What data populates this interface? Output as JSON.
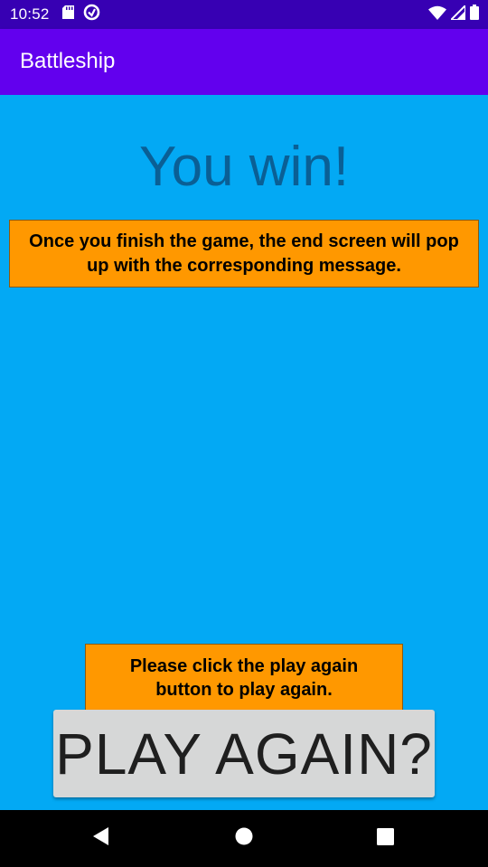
{
  "status_bar": {
    "time": "10:52",
    "icons": [
      "sd-card-icon",
      "data-saver-icon",
      "wifi-icon",
      "signal-icon",
      "battery-icon"
    ]
  },
  "app_bar": {
    "title": "Battleship"
  },
  "main": {
    "headline": "You win!",
    "hint_top": "Once you finish the game, the end screen will pop up with the corresponding message.",
    "hint_bottom": "Please click the play again button to play again.",
    "play_again_label": "PLAY AGAIN?"
  },
  "nav_bar": {
    "buttons": [
      "back-icon",
      "home-icon",
      "recents-icon"
    ]
  },
  "colors": {
    "status_bar": "#3700b3",
    "app_bar": "#6200ee",
    "background": "#03a9f4",
    "headline": "#0a5f95",
    "hint_box": "#ff9800",
    "button": "#d6d7d7"
  }
}
